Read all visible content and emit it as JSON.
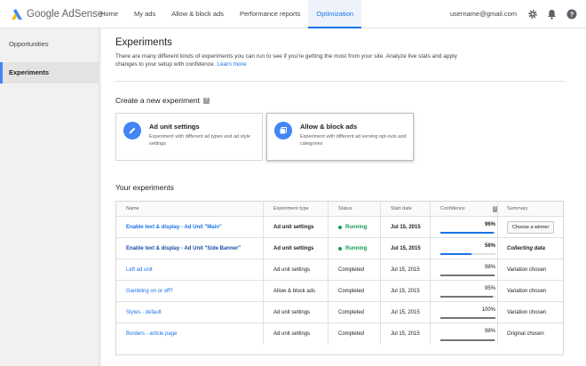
{
  "app": {
    "logo_text": "Google AdSense"
  },
  "nav": [
    "Home",
    "My ads",
    "Allow & block ads",
    "Performance reports",
    "Optimization"
  ],
  "user": {
    "email": "username@gmail.com"
  },
  "sidebar": {
    "items": [
      "Opportunities",
      "Experiments"
    ]
  },
  "main": {
    "title": "Experiments",
    "intro": "There are many different kinds of experiments you can run to see if you're getting the most from your site. Analyze live stats and apply changes to your setup with confidence.",
    "learn_more": "Learn more",
    "create_heading": "Create a new experiment",
    "help_glyph": "?",
    "cards": [
      {
        "title": "Ad unit settings",
        "desc": "Experiment with different ad types and ad style settings"
      },
      {
        "title": "Allow & block ads",
        "desc": "Experiment with different ad serving opt-outs and categories"
      }
    ],
    "your_heading": "Your experiments"
  },
  "table": {
    "headers": {
      "name": "Name",
      "type": "Experiment type",
      "status": "Status",
      "date": "Start date",
      "confidence": "Confidence",
      "summary": "Summary"
    },
    "rows": [
      {
        "name": "Enable text & display - Ad Unit \"Main\"",
        "type": "Ad unit settings",
        "status": "Running",
        "date": "Jul 15, 2015",
        "confidence": "96%",
        "summary": "Choose a winner"
      },
      {
        "name": "Enable text & display - Ad Unit \"Side Banner\"",
        "type": "Ad unit settings",
        "status": "Running",
        "date": "Jul 15, 2015",
        "confidence": "56%",
        "summary": "Collecting data"
      },
      {
        "name": "Left ad unit",
        "type": "Ad unit settings",
        "status": "Completed",
        "date": "Jul 15, 2015",
        "confidence": "98%",
        "summary": "Variation chosen"
      },
      {
        "name": "Gambling on or off?",
        "type": "Allow & block ads",
        "status": "Completed",
        "date": "Jul 15, 2015",
        "confidence": "95%",
        "summary": "Variation chosen"
      },
      {
        "name": "Styles - default",
        "type": "Ad unit settings",
        "status": "Completed",
        "date": "Jul 15, 2015",
        "confidence": "100%",
        "summary": "Variation chosen"
      },
      {
        "name": "Borders - article page",
        "type": "Ad unit settings",
        "status": "Completed",
        "date": "Jul 15, 2015",
        "confidence": "98%",
        "summary": "Original chosen"
      }
    ]
  },
  "colors": {
    "accent": "#1a73e8",
    "running": "#0f9d58",
    "bar_running": "#1a73e8",
    "bar_completed": "#757575"
  }
}
